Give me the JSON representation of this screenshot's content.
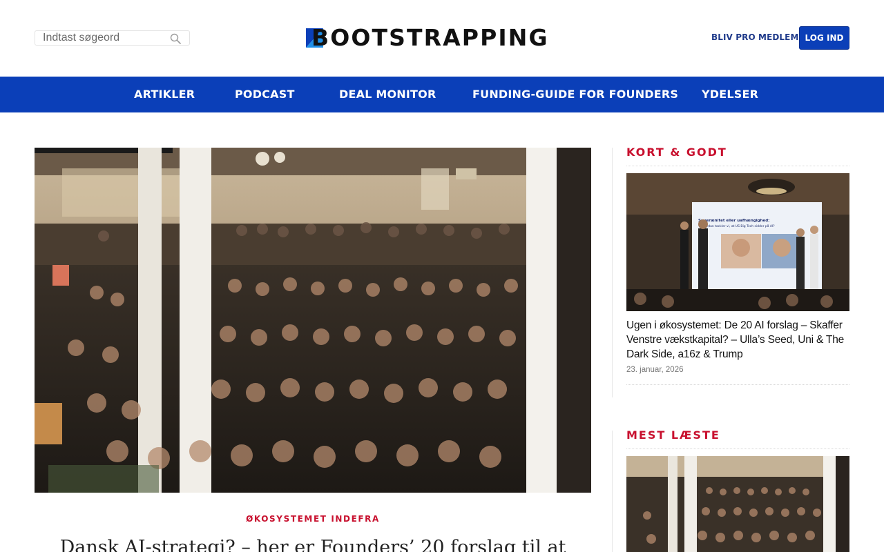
{
  "header": {
    "search": {
      "placeholder": "Indtast søgeord",
      "value": ""
    },
    "logo_text": "BOOTSTRAPPING",
    "pro_link": "BLIV PRO MEDLEM",
    "login_button": "LOG IND"
  },
  "nav": {
    "items": [
      {
        "label": "ARTIKLER"
      },
      {
        "label": "PODCAST"
      },
      {
        "label": "DEAL MONITOR"
      },
      {
        "label": "FUNDING-GUIDE FOR FOUNDERS"
      },
      {
        "label": "YDELSER"
      }
    ]
  },
  "main": {
    "category": "ØKOSYSTEMET INDEFRA",
    "headline": "Dansk AI-strategi? – her er Founders’ 20 forslag til at"
  },
  "sidebar": {
    "kort_godt": {
      "title": "KORT & GODT",
      "slide_text_line1": "Suverænitet eller uafhængighed:",
      "slide_text_line2": "– Hvordan tackler vi, at US Big Tech sidder på AI?",
      "article_title": "Ugen i økosystemet: De 20 AI forslag – Skaffer Venstre vækstkapital? – Ulla’s Seed, Uni & The Dark Side, a16z & Trump",
      "date": "23. januar, 2026"
    },
    "mest_laeste": {
      "title": "MEST LÆSTE"
    }
  },
  "colors": {
    "brand_blue": "#0b3fb8",
    "accent_red": "#c8102e",
    "link_blue": "#1f3a8a"
  },
  "icons": {
    "search": "search-icon",
    "logo_mark": "logo-mark-icon"
  }
}
